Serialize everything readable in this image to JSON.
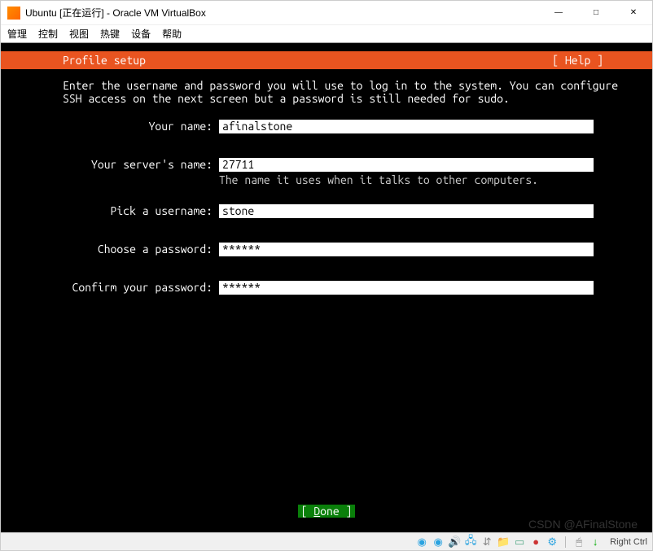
{
  "window": {
    "title": "Ubuntu [正在运行] - Oracle VM VirtualBox"
  },
  "menubar": {
    "items": [
      "管理",
      "控制",
      "视图",
      "热键",
      "设备",
      "帮助"
    ]
  },
  "installer": {
    "header_title": "Profile setup",
    "help_label": "[ Help ]",
    "intro": "Enter the username and password you will use to log in to the system. You can configure SSH access on the next screen but a password is still needed for sudo.",
    "fields": {
      "name_label": "Your name:",
      "name_value": "afinalstone",
      "server_label": "Your server's name:",
      "server_value": "27711",
      "server_hint": "The name it uses when it talks to other computers.",
      "username_label": "Pick a username:",
      "username_value": "stone",
      "password_label": "Choose a password:",
      "password_value": "******",
      "confirm_label": "Confirm your password:",
      "confirm_value": "******"
    },
    "done_left": "[ ",
    "done_mid": "D",
    "done_rest": "one",
    "done_right": "       ]"
  },
  "statusbar": {
    "host_key": "Right Ctrl"
  }
}
